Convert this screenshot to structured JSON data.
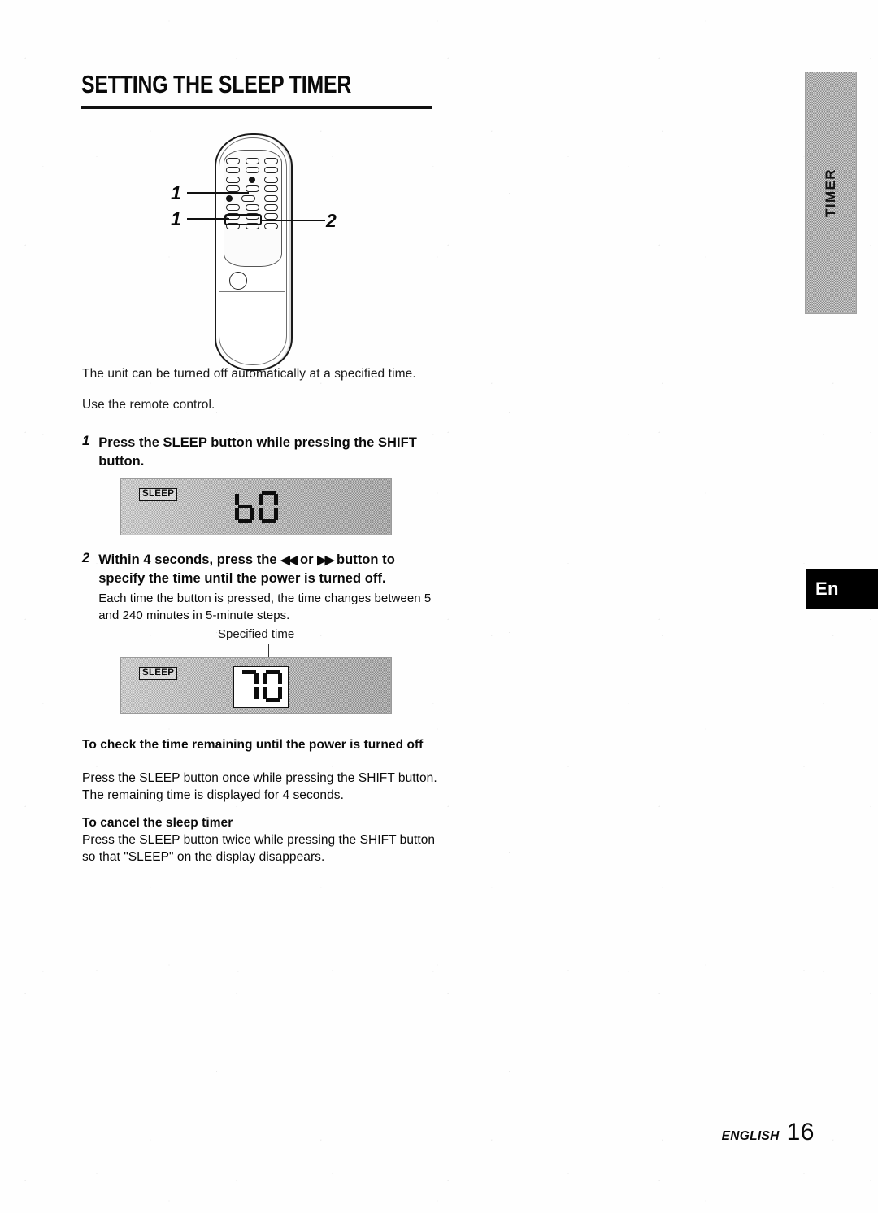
{
  "document": {
    "title": "SETTING THE  SLEEP TIMER",
    "intro_1": "The unit can be turned off automatically at a specified time.",
    "intro_2": "Use the remote control."
  },
  "figure": {
    "callout_1a": "1",
    "callout_1b": "1",
    "callout_2": "2"
  },
  "steps": [
    {
      "number": "1",
      "heading": "Press the SLEEP button while pressing the SHIFT button.",
      "sub": ""
    },
    {
      "number": "2",
      "heading_part1": "Within 4 seconds, press the",
      "glyph_rew": "◀◀",
      "heading_or": "or",
      "glyph_ffwd": "▶▶",
      "heading_part2": "button to specify the time until the power is turned off.",
      "sub": "Each time the button is pressed, the time changes between 5 and 240 minutes in 5-minute steps."
    }
  ],
  "displays": [
    {
      "indicator": "SLEEP",
      "value": "60"
    },
    {
      "indicator": "SLEEP",
      "value": "70",
      "annotation": "Specified time"
    }
  ],
  "sections": [
    {
      "heading": "To check the time remaining until the power is turned off",
      "body": "Press the SLEEP button once while pressing the SHIFT button. The remaining time is displayed for 4 seconds."
    },
    {
      "heading": "To cancel the sleep timer",
      "body": "Press the SLEEP button twice while pressing the SHIFT button so that \"SLEEP\" on the display disappears."
    }
  ],
  "tabs": {
    "side_tab": "TIMER",
    "language_badge": "En"
  },
  "footer": {
    "language": "ENGLISH",
    "page_number": "16"
  },
  "colors": {
    "ink": "#0a0a0a",
    "paper": "#fefefe",
    "lcd_gray": "#b6b6b6",
    "tab_gray": "#b0b0b0",
    "badge_black": "#000000"
  }
}
